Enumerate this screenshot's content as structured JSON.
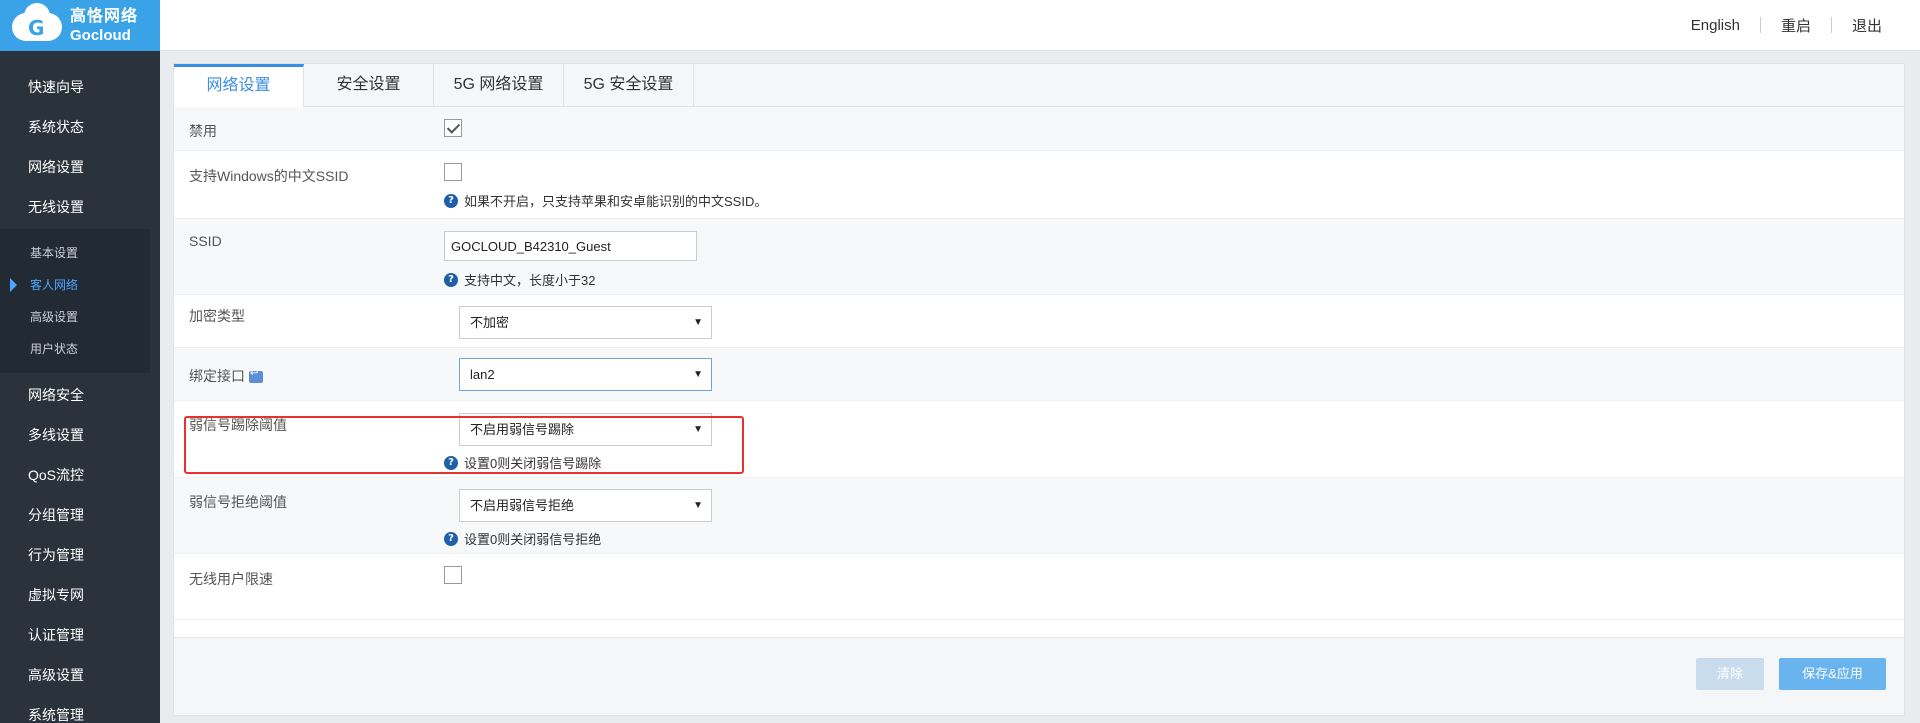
{
  "brand": {
    "cn": "高恪网络",
    "en": "Gocloud"
  },
  "topbar": {
    "english": "English",
    "reboot": "重启",
    "logout": "退出"
  },
  "nav": {
    "items_before": [
      "快速向导",
      "系统状态",
      "网络设置",
      "无线设置"
    ],
    "sub": [
      "基本设置",
      "客人网络",
      "高级设置",
      "用户状态"
    ],
    "active_sub": "客人网络",
    "items_after": [
      "网络安全",
      "多线设置",
      "QoS流控",
      "分组管理",
      "行为管理",
      "虚拟专网",
      "认证管理",
      "高级设置",
      "系统管理"
    ]
  },
  "tabs": [
    "网络设置",
    "安全设置",
    "5G 网络设置",
    "5G 安全设置"
  ],
  "active_tab": "网络设置",
  "form": {
    "disable": {
      "label": "禁用",
      "checked": true
    },
    "cn_ssid": {
      "label": "支持Windows的中文SSID",
      "checked": false,
      "hint": "如果不开启，只支持苹果和安卓能识别的中文SSID。"
    },
    "ssid": {
      "label": "SSID",
      "value": "GOCLOUD_B42310_Guest",
      "hint": "支持中文，长度小于32"
    },
    "encryption": {
      "label": "加密类型",
      "value": "不加密"
    },
    "bind_iface": {
      "label": "绑定接口",
      "value": "lan2"
    },
    "weak_kick": {
      "label": "弱信号踢除阈值",
      "value": "不启用弱信号踢除",
      "hint": "设置0则关闭弱信号踢除"
    },
    "weak_reject": {
      "label": "弱信号拒绝阈值",
      "value": "不启用弱信号拒绝",
      "hint": "设置0则关闭弱信号拒绝"
    },
    "rate_limit": {
      "label": "无线用户限速",
      "checked": false
    }
  },
  "buttons": {
    "clear": "清除",
    "save": "保存&应用"
  },
  "colors": {
    "accent": "#3a8ee6",
    "sidebar": "#2a323c",
    "highlight": "#e5322d"
  }
}
